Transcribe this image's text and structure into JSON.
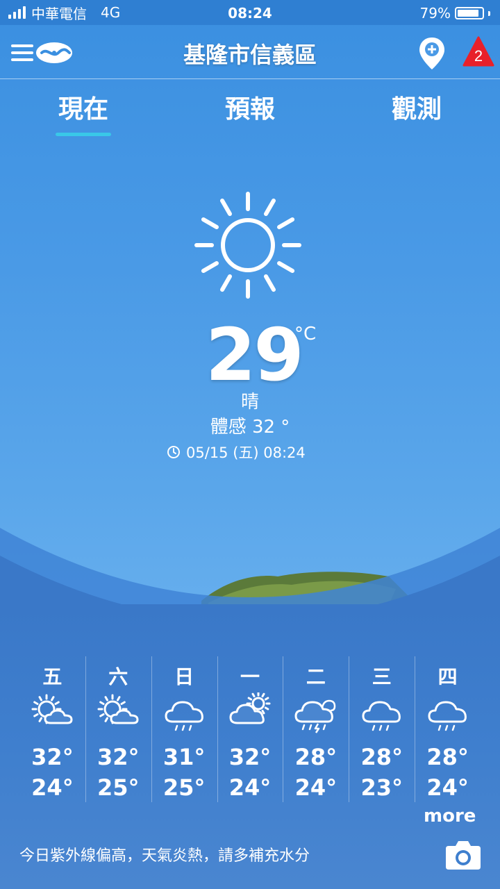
{
  "status": {
    "carrier": "中華電信",
    "network": "4G",
    "time": "08:24",
    "battery": "79%",
    "battery_level": 0.79
  },
  "header": {
    "location": "基隆市信義區",
    "alert_count": "2"
  },
  "tabs": [
    {
      "label": "現在",
      "active": true
    },
    {
      "label": "預報"
    },
    {
      "label": "觀測"
    }
  ],
  "current": {
    "icon": "sun-icon",
    "temp": "29",
    "unit": "°C",
    "condition": "晴",
    "feels_like": "體感 32 °",
    "time": "05/15 (五) 08:24"
  },
  "forecast": [
    {
      "day": "五",
      "icon": "sun-cloud-icon",
      "high": "32°",
      "low": "24°"
    },
    {
      "day": "六",
      "icon": "sun-cloud-icon",
      "high": "32°",
      "low": "25°"
    },
    {
      "day": "日",
      "icon": "rain-cloud-icon",
      "high": "31°",
      "low": "25°"
    },
    {
      "day": "一",
      "icon": "cloud-sun-icon",
      "high": "32°",
      "low": "24°"
    },
    {
      "day": "二",
      "icon": "thunder-rain-icon",
      "high": "28°",
      "low": "24°"
    },
    {
      "day": "三",
      "icon": "rain-cloud-icon",
      "high": "28°",
      "low": "23°"
    },
    {
      "day": "四",
      "icon": "rain-cloud-icon",
      "high": "28°",
      "low": "24°"
    }
  ],
  "more_label": "more",
  "tip": "今日紫外線偏高，天氣炎熱，請多補充水分",
  "colors": {
    "tab_indicator": "#39c8e8",
    "alert": "#e8202a"
  }
}
